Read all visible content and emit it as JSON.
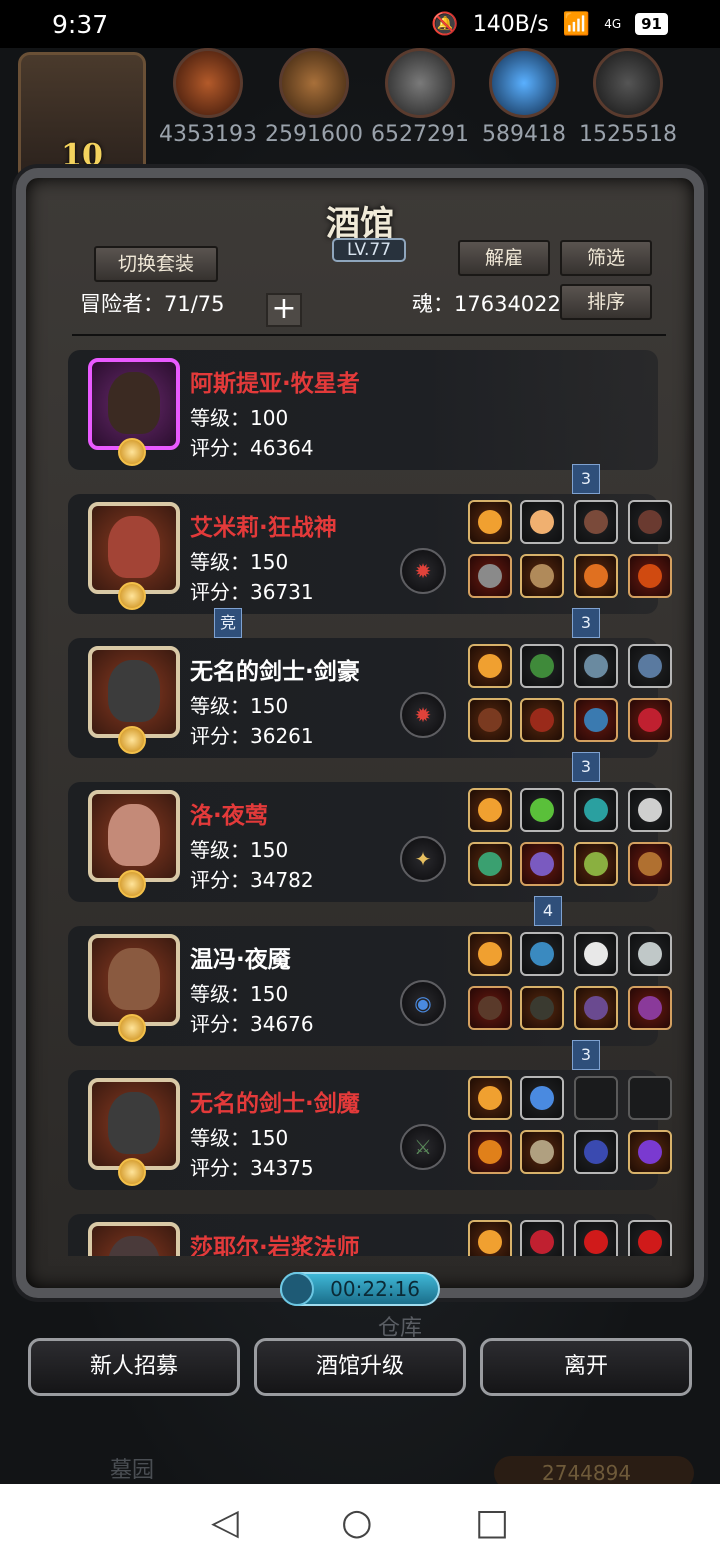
{
  "status": {
    "time": "9:37",
    "speed": "140B/s",
    "network": "4G",
    "battery": "91"
  },
  "resources": [
    {
      "icon": "meat-icon",
      "value": "4353193"
    },
    {
      "icon": "wood-icon",
      "value": "2591600"
    },
    {
      "icon": "stone-icon",
      "value": "6527291"
    },
    {
      "icon": "crystal-icon",
      "value": "589418"
    },
    {
      "icon": "iron-icon",
      "value": "1525518"
    }
  ],
  "crown_level": "10",
  "tavern": {
    "title": "酒馆",
    "level": "LV.77",
    "switch_set": "切换套装",
    "dismiss": "解雇",
    "filter": "筛选",
    "sort": "排序",
    "adventurers": "冒险者：71/75",
    "soul": "魂：17634022",
    "plus": "+"
  },
  "heroes": [
    {
      "name": "阿斯提亚·牧星者",
      "level": "等级：100",
      "score": "评分：46364",
      "name_color": "red",
      "frame": "pink"
    },
    {
      "name": "艾米莉·狂战神",
      "level": "等级：150",
      "score": "评分：36731",
      "name_color": "red",
      "frame": "gold",
      "tag": "3"
    },
    {
      "name": "无名的剑士·剑豪",
      "level": "等级：150",
      "score": "评分：36261",
      "name_color": "white",
      "frame": "gold",
      "tag": "3"
    },
    {
      "name": "洛·夜莺",
      "level": "等级：150",
      "score": "评分：34782",
      "name_color": "red",
      "frame": "gold",
      "tag": "3"
    },
    {
      "name": "温冯·夜魇",
      "level": "等级：150",
      "score": "评分：34676",
      "name_color": "white",
      "frame": "gold",
      "tag": "4"
    },
    {
      "name": "无名的剑士·剑魔",
      "level": "等级：150",
      "score": "评分：34375",
      "name_color": "red",
      "frame": "gold",
      "tag": "3"
    },
    {
      "name": "莎耶尔·岩浆法师",
      "level": "",
      "score": "",
      "name_color": "red",
      "frame": "gold"
    }
  ],
  "compete_tag": "竞",
  "timer": "00:22:16",
  "warehouse": "仓库",
  "buttons": {
    "recruit": "新人招募",
    "upgrade": "酒馆升级",
    "leave": "离开"
  },
  "bottom_label": "墓园",
  "gold": "2744894"
}
